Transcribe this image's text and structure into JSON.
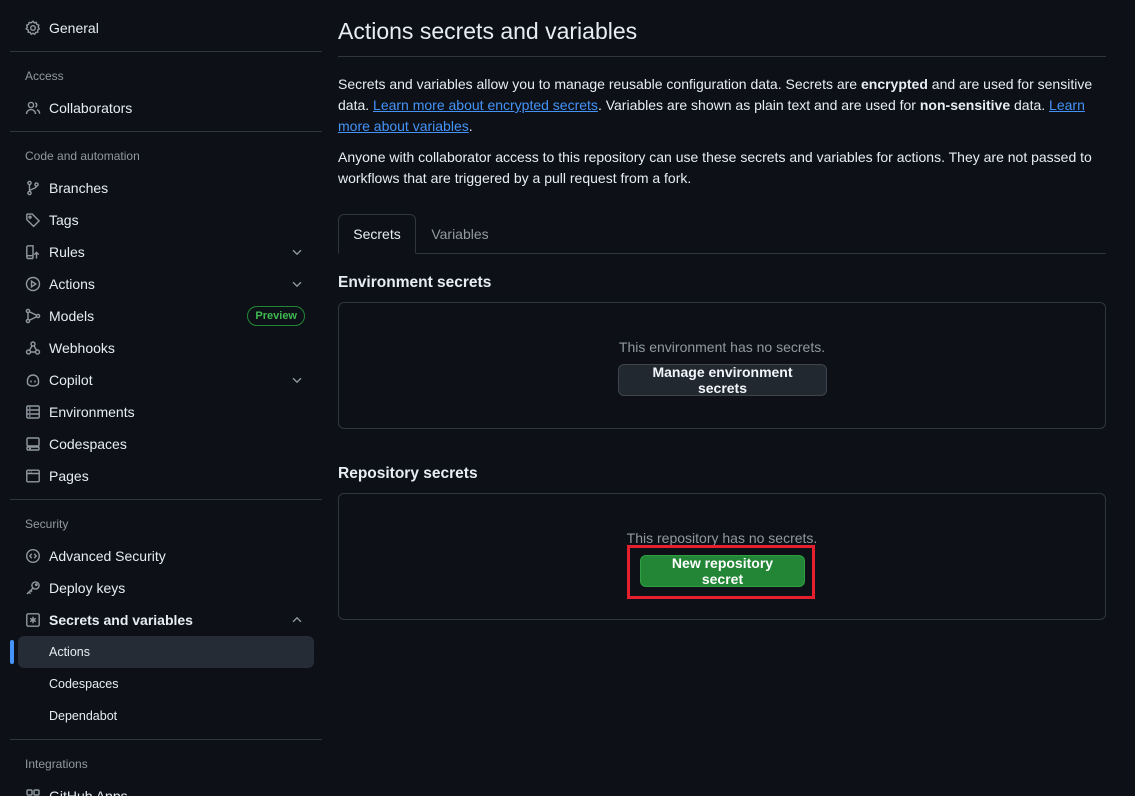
{
  "sidebar": {
    "general": "General",
    "access_heading": "Access",
    "collaborators": "Collaborators",
    "code_heading": "Code and automation",
    "branches": "Branches",
    "tags": "Tags",
    "rules": "Rules",
    "actions": "Actions",
    "models": "Models",
    "models_badge": "Preview",
    "webhooks": "Webhooks",
    "copilot": "Copilot",
    "environments": "Environments",
    "codespaces": "Codespaces",
    "pages": "Pages",
    "security_heading": "Security",
    "advanced_security": "Advanced Security",
    "deploy_keys": "Deploy keys",
    "secrets_and_variables": "Secrets and variables",
    "sub_actions": "Actions",
    "sub_codespaces": "Codespaces",
    "sub_dependabot": "Dependabot",
    "integrations_heading": "Integrations",
    "github_apps": "GitHub Apps"
  },
  "main": {
    "title": "Actions secrets and variables",
    "intro": {
      "t1": "Secrets and variables allow you to manage reusable configuration data. Secrets are ",
      "b1": "encrypted",
      "t2": " and are used for sensitive data. ",
      "link1": "Learn more about encrypted secrets",
      "t3": ". Variables are shown as plain text and are used for ",
      "b2": "non-sensitive",
      "t4": " data. ",
      "link2": "Learn more about variables",
      "t5": "."
    },
    "access_note": "Anyone with collaborator access to this repository can use these secrets and variables for actions. They are not passed to workflows that are triggered by a pull request from a fork.",
    "tabs": {
      "secrets": "Secrets",
      "variables": "Variables"
    },
    "env_secrets": {
      "heading": "Environment secrets",
      "empty": "This environment has no secrets.",
      "button": "Manage environment secrets"
    },
    "repo_secrets": {
      "heading": "Repository secrets",
      "empty": "This repository has no secrets.",
      "button": "New repository secret"
    }
  },
  "colors": {
    "background": "#0d1117",
    "primary_button": "#238636",
    "link": "#4493f8",
    "highlight": "#e5202e"
  }
}
